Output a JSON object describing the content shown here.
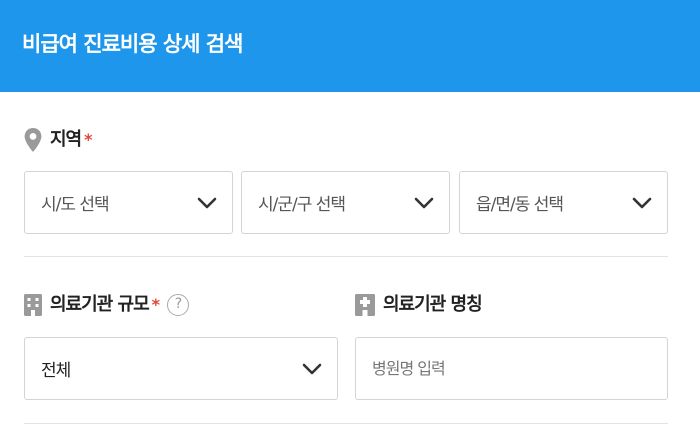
{
  "header": {
    "title": "비급여 진료비용 상세 검색"
  },
  "region": {
    "label": "지역",
    "required_mark": "*",
    "selects": [
      {
        "value": "시/도 선택"
      },
      {
        "value": "시/군/구 선택"
      },
      {
        "value": "읍/면/동 선택"
      }
    ]
  },
  "institution_scale": {
    "label": "의료기관 규모",
    "required_mark": "*",
    "help_mark": "?",
    "select_value": "전체"
  },
  "institution_name": {
    "label": "의료기관 명칭",
    "placeholder": "병원명 입력",
    "value": ""
  },
  "colors": {
    "header_bg": "#1e96eb",
    "required": "#e0463c",
    "border": "#d4d4d4"
  },
  "icons": [
    "location-pin-icon",
    "building-icon",
    "hospital-icon",
    "help-icon",
    "chevron-down-icon"
  ]
}
